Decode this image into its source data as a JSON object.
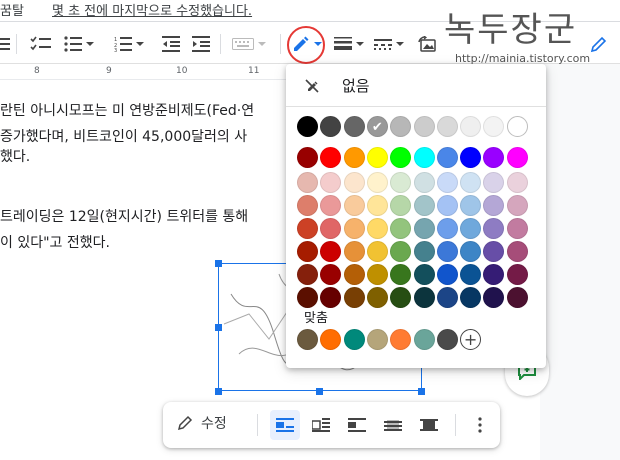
{
  "top": {
    "left_text": "꿈탈",
    "title_text": "몇 초 전에 마지막으로 수정했습니다."
  },
  "watermark": {
    "title": "녹두장군",
    "url": "http://mainia.tistory.com"
  },
  "ruler": {
    "numbers": [
      "8",
      "9",
      "10",
      "11"
    ]
  },
  "document": {
    "lines": [
      "란틴 아니시모프는 미 연방준비제도(Fed·연",
      "증가했다며, 비트코인이 45,000달러의 사",
      "했다.",
      "트레이딩은 12일(현지시간) 트위터를 통해",
      "이 있다\"고 전했다."
    ]
  },
  "palette": {
    "none_label": "없음",
    "custom_label": "맞춤",
    "selected": "#999999",
    "rows": [
      [
        "#000000",
        "#434343",
        "#666666",
        "#999999",
        "#b7b7b7",
        "#cccccc",
        "#d9d9d9",
        "#efefef",
        "#f3f3f3",
        "#ffffff"
      ],
      [
        "#980000",
        "#ff0000",
        "#ff9900",
        "#ffff00",
        "#00ff00",
        "#00ffff",
        "#4a86e8",
        "#0000ff",
        "#9900ff",
        "#ff00ff"
      ],
      [
        "#e6b8af",
        "#f4cccc",
        "#fce5cd",
        "#fff2cc",
        "#d9ead3",
        "#d0e0e3",
        "#c9daf8",
        "#cfe2f3",
        "#d9d2e9",
        "#ead1dc"
      ],
      [
        "#dd7e6b",
        "#ea9999",
        "#f9cb9c",
        "#ffe599",
        "#b6d7a8",
        "#a2c4c9",
        "#a4c2f4",
        "#9fc5e8",
        "#b4a7d6",
        "#d5a6bd"
      ],
      [
        "#cc4125",
        "#e06666",
        "#f6b26b",
        "#ffd966",
        "#93c47d",
        "#76a5af",
        "#6d9eeb",
        "#6fa8dc",
        "#8e7cc3",
        "#c27ba0"
      ],
      [
        "#a61c00",
        "#cc0000",
        "#e69138",
        "#f1c232",
        "#6aa84f",
        "#45818e",
        "#3c78d8",
        "#3d85c6",
        "#674ea7",
        "#a64d79"
      ],
      [
        "#85200c",
        "#990000",
        "#b45f06",
        "#bf9000",
        "#38761d",
        "#134f5c",
        "#1155cc",
        "#0b5394",
        "#351c75",
        "#741b47"
      ],
      [
        "#5b0f00",
        "#660000",
        "#783f04",
        "#7f6000",
        "#274e13",
        "#0c343d",
        "#1c4587",
        "#073763",
        "#20124d",
        "#4c1130"
      ]
    ],
    "custom_colors": [
      "#6b5a3e",
      "#ff6d01",
      "#00897b",
      "#b5a57a",
      "#ff7b32",
      "#6aa59a",
      "#4a4a4a"
    ]
  },
  "image_toolbar": {
    "edit_label": "수정"
  },
  "icons": {
    "pen": "pen-icon",
    "comment": "comment-add-icon"
  },
  "colors": {
    "accent": "#1a73e8",
    "ring": "#e53935"
  }
}
